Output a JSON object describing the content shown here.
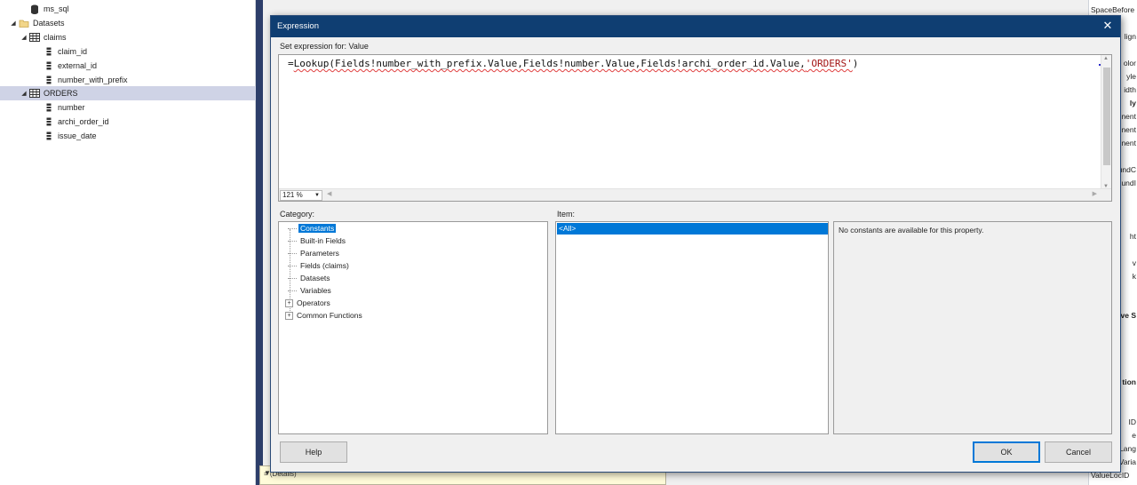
{
  "tree": {
    "items": [
      {
        "label": "ms_sql",
        "icon": "database-icon"
      },
      {
        "label": "Datasets",
        "icon": "folder-icon"
      },
      {
        "label": "claims",
        "icon": "table-icon"
      },
      {
        "label": "claim_id",
        "icon": "field-icon"
      },
      {
        "label": "external_id",
        "icon": "field-icon"
      },
      {
        "label": "number_with_prefix",
        "icon": "field-icon"
      },
      {
        "label": "ORDERS",
        "icon": "table-icon"
      },
      {
        "label": "number",
        "icon": "field-icon"
      },
      {
        "label": "archi_order_id",
        "icon": "field-icon"
      },
      {
        "label": "issue_date",
        "icon": "field-icon"
      }
    ]
  },
  "bottom_strip": {
    "text": "= (Details)"
  },
  "properties": {
    "rows": [
      "SpaceBefore",
      "lign",
      "olor",
      "yle",
      "idth",
      "ly",
      "nent",
      "nent",
      "nent",
      "undC",
      "undI",
      "ht",
      "v",
      "k",
      "ive S",
      "tion",
      "ID",
      "e",
      "Lang",
      "Varia",
      "ValueLocID"
    ]
  },
  "dialog": {
    "title": "Expression",
    "close_glyph": "✕",
    "set_expression_label": "Set expression for: Value",
    "expression": {
      "prefix": "=",
      "code": "Lookup(Fields!number_with_prefix.Value,Fields!number.Value,Fields!archi_order_id.Value,",
      "string_literal": "'ORDERS'",
      "suffix": ")"
    },
    "zoom": "121 %",
    "category_label": "Category:",
    "item_label": "Item:",
    "categories": [
      {
        "label": "Constants",
        "expandable": false,
        "selected": true
      },
      {
        "label": "Built-in Fields",
        "expandable": false,
        "selected": false
      },
      {
        "label": "Parameters",
        "expandable": false,
        "selected": false
      },
      {
        "label": "Fields (claims)",
        "expandable": false,
        "selected": false
      },
      {
        "label": "Datasets",
        "expandable": false,
        "selected": false
      },
      {
        "label": "Variables",
        "expandable": false,
        "selected": false
      },
      {
        "label": "Operators",
        "expandable": true,
        "selected": false
      },
      {
        "label": "Common Functions",
        "expandable": true,
        "selected": false
      }
    ],
    "items": [
      "<All>"
    ],
    "description": "No constants are available for this property.",
    "buttons": {
      "help": "Help",
      "ok": "OK",
      "cancel": "Cancel"
    },
    "colors": {
      "titlebar": "#0f3e72",
      "selection": "#0078d7",
      "string": "#a31515"
    }
  }
}
